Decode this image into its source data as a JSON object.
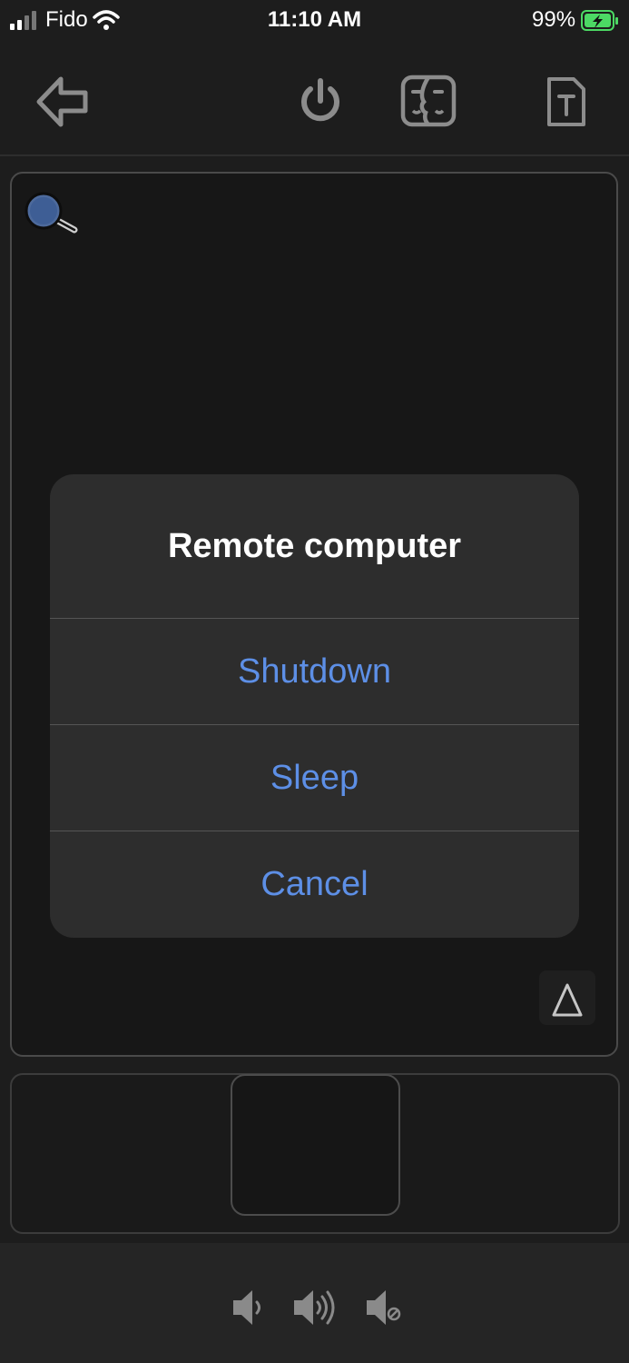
{
  "status_bar": {
    "carrier": "Fido",
    "time": "11:10 AM",
    "battery": "99%"
  },
  "toolbar": {
    "icons": [
      "back-arrow-icon",
      "power-icon",
      "faces-icon",
      "text-document-icon"
    ]
  },
  "trackpad": {
    "magnifier_icon": "magnifier-icon",
    "toggle_icon": "triangle-icon"
  },
  "alert": {
    "title": "Remote computer",
    "buttons": {
      "shutdown": "Shutdown",
      "sleep": "Sleep",
      "cancel": "Cancel"
    }
  },
  "volume": {
    "icons": [
      "volume-down-icon",
      "volume-up-icon",
      "mute-icon"
    ]
  },
  "colors": {
    "accent": "#5d8fe6",
    "battery_green": "#4cd964"
  }
}
